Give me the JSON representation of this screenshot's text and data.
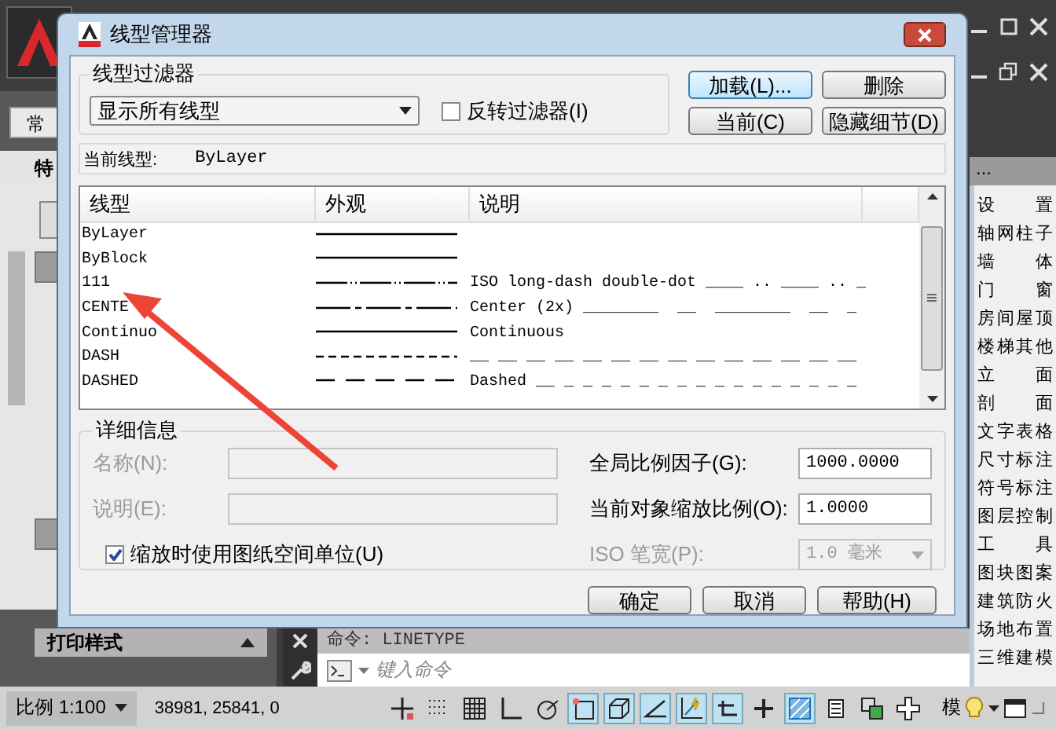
{
  "app": {
    "ribbon_tab": "常",
    "palette_tab": "特",
    "left_buttons": [
      {
        "kind": "dropdown"
      },
      {
        "kind": "section"
      },
      {
        "kind": "section"
      }
    ],
    "print_style": "打印样式",
    "tool_palette": {
      "header": "...",
      "items": [
        "设置",
        "轴网柱子",
        "墙体",
        "门窗",
        "房间屋顶",
        "楼梯其他",
        "立面",
        "剖面",
        "文字表格",
        "尺寸标注",
        "符号标注",
        "图层控制",
        "工具",
        "图块图案",
        "建筑防火",
        "场地布置",
        "三维建模"
      ]
    },
    "command": {
      "history": "命令: LINETYPE",
      "placeholder": "键入命令"
    },
    "status_bar": {
      "scale": "比例 1:100",
      "coordinates": "38981, 25841, 0",
      "model": "模",
      "toggles": [
        {
          "kind": "cross",
          "on": false
        },
        {
          "kind": "dots",
          "on": false
        },
        {
          "kind": "grid",
          "on": false
        },
        {
          "kind": "ortho",
          "on": false
        },
        {
          "kind": "polar",
          "on": false
        },
        {
          "kind": "osnap",
          "on": true
        },
        {
          "kind": "cube",
          "on": true
        },
        {
          "kind": "angle",
          "on": true
        },
        {
          "kind": "bolt",
          "on": true
        },
        {
          "kind": "tee",
          "on": true
        },
        {
          "kind": "plus",
          "on": false
        },
        {
          "kind": "hatch",
          "on": true
        },
        {
          "kind": "list",
          "on": false
        },
        {
          "kind": "layers",
          "on": false
        },
        {
          "kind": "bigplus",
          "on": false
        }
      ]
    }
  },
  "dialog": {
    "title": "线型管理器",
    "filter": {
      "legend": "线型过滤器",
      "value": "显示所有线型",
      "invert_label": "反转过滤器(I)",
      "invert_checked": false
    },
    "buttons": [
      "加载(L)...",
      "删除",
      "当前(C)",
      "隐藏细节(D)"
    ],
    "current_linetype": {
      "label": "当前线型:",
      "value": "ByLayer"
    },
    "list": {
      "columns": [
        "线型",
        "外观",
        "说明"
      ],
      "rows": [
        {
          "name": "ByLayer",
          "kind": "continuous"
        },
        {
          "name": "ByBlock",
          "kind": "continuous"
        },
        {
          "name": "111",
          "kind": "dash-double-dot",
          "description": "ISO long-dash double-dot ____ .. ____ .. _"
        },
        {
          "name": "CENTE",
          "kind": "center",
          "description": "Center (2x) ________  __  ________  __  _"
        },
        {
          "name": "Continuo",
          "kind": "continuous",
          "description": "Continuous"
        },
        {
          "name": "DASH",
          "kind": "dash",
          "description": "__ __ __ __ __ __ __ __ __ __ __ __ __ __"
        },
        {
          "name": "DASHED",
          "kind": "dashed",
          "description": "Dashed __ _ _ _ _ _ _ _ _ _ _ _ _ _ _ _ _"
        }
      ]
    },
    "details": {
      "legend": "详细信息",
      "name": {
        "label": "名称(N):",
        "disabled": true
      },
      "description": {
        "label": "说明(E):",
        "disabled": true
      },
      "paper_space_units": {
        "label": "缩放时使用图纸空间单位(U)",
        "checked": true
      },
      "global_scale": {
        "label": "全局比例因子(G):",
        "value": "1000.0000"
      },
      "object_scale": {
        "label": "当前对象缩放比例(O):",
        "value": "1.0000"
      },
      "iso_pen_width": {
        "label": "ISO 笔宽(P):",
        "value": "1.0 毫米",
        "disabled": true
      }
    },
    "footer_buttons": [
      "确定",
      "取消",
      "帮助(H)"
    ]
  },
  "annotation": {
    "kind": "arrow"
  }
}
